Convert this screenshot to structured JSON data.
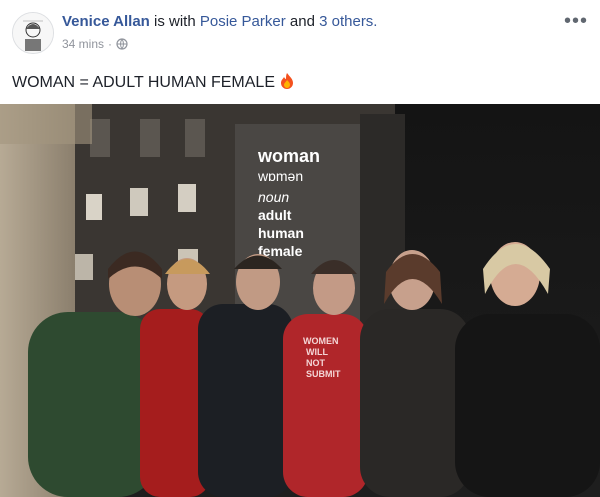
{
  "post": {
    "author": "Venice Allan",
    "with_text": "is with",
    "tagged": "Posie Parker",
    "and_text": "and",
    "others": "3 others.",
    "timestamp": "34 mins",
    "separator": "·",
    "text": "WOMAN = ADULT HUMAN FEMALE",
    "privacy_icon": "globe-icon",
    "more_icon": "more-options-icon"
  },
  "photo": {
    "projection": {
      "lines": [
        "woman",
        "wɒmən",
        "noun",
        "adult",
        "human",
        "female"
      ]
    },
    "shirt_text": [
      "WOMEN",
      "WILL",
      "NOT",
      "SUBMIT"
    ]
  }
}
